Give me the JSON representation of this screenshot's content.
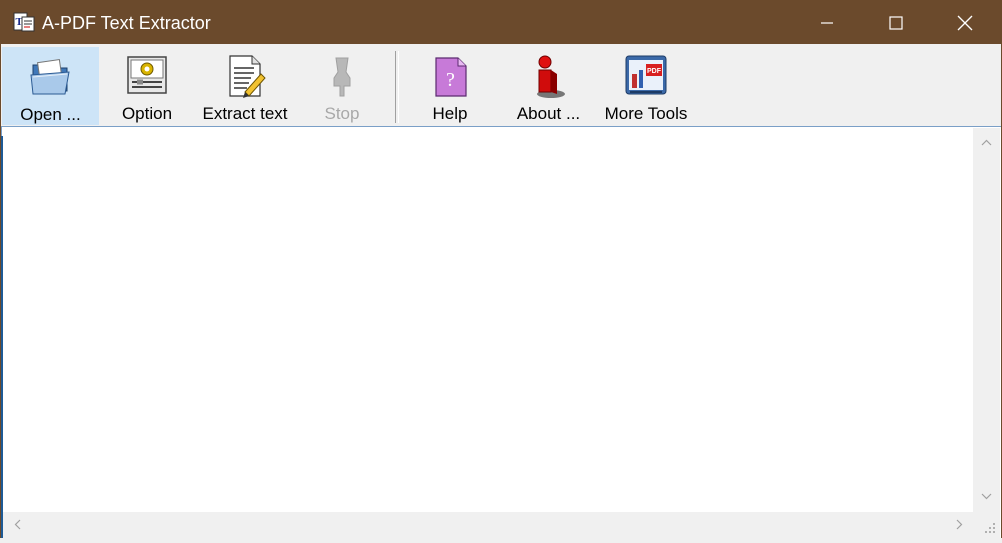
{
  "window": {
    "title": "A-PDF Text Extractor",
    "icon": "app-icon",
    "controls": [
      "minimize-icon",
      "maximize-icon",
      "close-icon"
    ]
  },
  "toolbar": {
    "buttons": [
      {
        "label": "Open ...",
        "icon": "open-folder-icon",
        "state": "active"
      },
      {
        "label": "Option",
        "icon": "option-gear-icon",
        "state": "normal"
      },
      {
        "label": "Extract text",
        "icon": "extract-text-icon",
        "state": "normal"
      },
      {
        "label": "Stop",
        "icon": "stop-icon",
        "state": "disabled"
      },
      {
        "label": "Help",
        "icon": "help-icon",
        "state": "normal"
      },
      {
        "label": "About ...",
        "icon": "about-info-icon",
        "state": "normal"
      },
      {
        "label": "More Tools",
        "icon": "more-tools-icon",
        "state": "normal"
      }
    ]
  },
  "content": {
    "text": ""
  },
  "colors": {
    "titlebar": "#6b4a2c",
    "active_button": "#cde4f7",
    "accent": "#0b6cb3"
  }
}
